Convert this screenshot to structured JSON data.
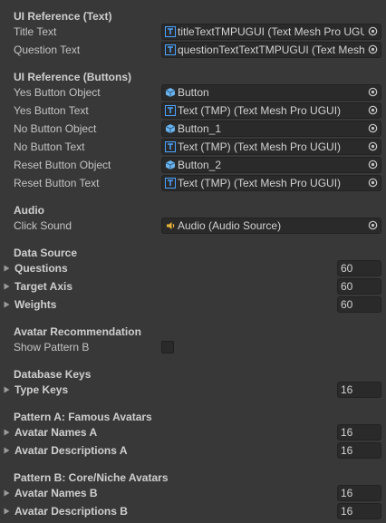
{
  "ui_text": {
    "header": "UI Reference (Text)",
    "fields": [
      {
        "label": "Title Text",
        "value": "titleTextTMPUGUI (Text Mesh Pro UGUI)",
        "icon": "text-mesh-pro-icon"
      },
      {
        "label": "Question Text",
        "value": "questionTextTextTMPUGUI (Text Mesh Pro UGUI)",
        "icon": "text-mesh-pro-icon"
      }
    ]
  },
  "ui_buttons": {
    "header": "UI Reference (Buttons)",
    "fields": [
      {
        "label": "Yes Button Object",
        "value": "Button",
        "icon": "gameobject-cube-icon"
      },
      {
        "label": "Yes Button Text",
        "value": "Text (TMP) (Text Mesh Pro UGUI)",
        "icon": "text-mesh-pro-icon"
      },
      {
        "label": "No Button Object",
        "value": "Button_1",
        "icon": "gameobject-cube-icon"
      },
      {
        "label": "No Button Text",
        "value": "Text (TMP) (Text Mesh Pro UGUI)",
        "icon": "text-mesh-pro-icon"
      },
      {
        "label": "Reset Button Object",
        "value": "Button_2",
        "icon": "gameobject-cube-icon"
      },
      {
        "label": "Reset Button Text",
        "value": "Text (TMP) (Text Mesh Pro UGUI)",
        "icon": "text-mesh-pro-icon"
      }
    ]
  },
  "audio": {
    "header": "Audio",
    "click_sound": {
      "label": "Click Sound",
      "value": "Audio (Audio Source)",
      "icon": "audio-source-icon"
    }
  },
  "data_source": {
    "header": "Data Source",
    "arrays": [
      {
        "label": "Questions",
        "size": "60"
      },
      {
        "label": "Target Axis",
        "size": "60"
      },
      {
        "label": "Weights",
        "size": "60"
      }
    ]
  },
  "avatar_recommendation": {
    "header": "Avatar Recommendation",
    "show_pattern_b": {
      "label": "Show Pattern B",
      "checked": false
    }
  },
  "database_keys": {
    "header": "Database Keys",
    "arrays": [
      {
        "label": "Type Keys",
        "size": "16"
      }
    ]
  },
  "pattern_a": {
    "header": "Pattern A: Famous Avatars",
    "arrays": [
      {
        "label": "Avatar Names A",
        "size": "16"
      },
      {
        "label": "Avatar Descriptions A",
        "size": "16"
      }
    ]
  },
  "pattern_b": {
    "header": "Pattern B: Core/Niche Avatars",
    "arrays": [
      {
        "label": "Avatar Names B",
        "size": "16"
      },
      {
        "label": "Avatar Descriptions B",
        "size": "16"
      }
    ]
  },
  "colors": {
    "background": "#383838",
    "field_background": "#2a2a2a",
    "tmp_icon": "#4aa3ff",
    "cube_icon": "#6cb4ee",
    "audio_icon": "#e8b23a"
  }
}
